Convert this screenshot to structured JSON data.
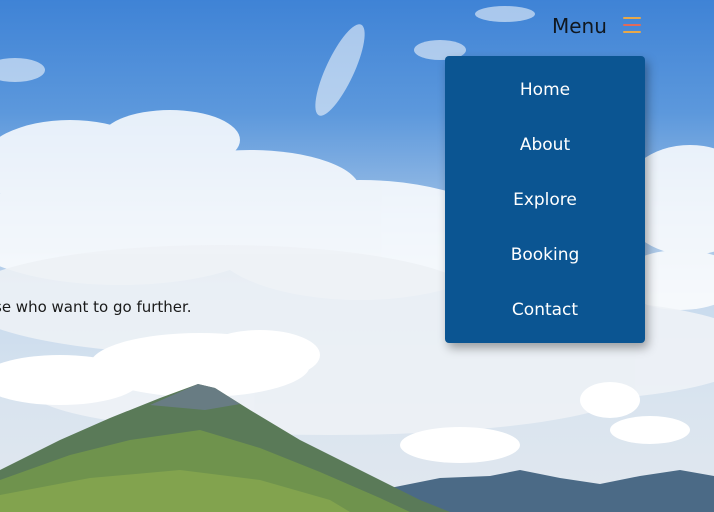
{
  "hero": {
    "tagline": "se who want to go further."
  },
  "header": {
    "menu_label": "Menu",
    "menu_icon": "hamburger-icon"
  },
  "nav": {
    "items": [
      {
        "label": "Home"
      },
      {
        "label": "About"
      },
      {
        "label": "Explore"
      },
      {
        "label": "Booking"
      },
      {
        "label": "Contact"
      }
    ]
  },
  "colors": {
    "dropdown_bg": "#0b5592",
    "hamburger_bars": [
      "#e7a84a",
      "#e26a5a",
      "#e7a84a"
    ]
  }
}
